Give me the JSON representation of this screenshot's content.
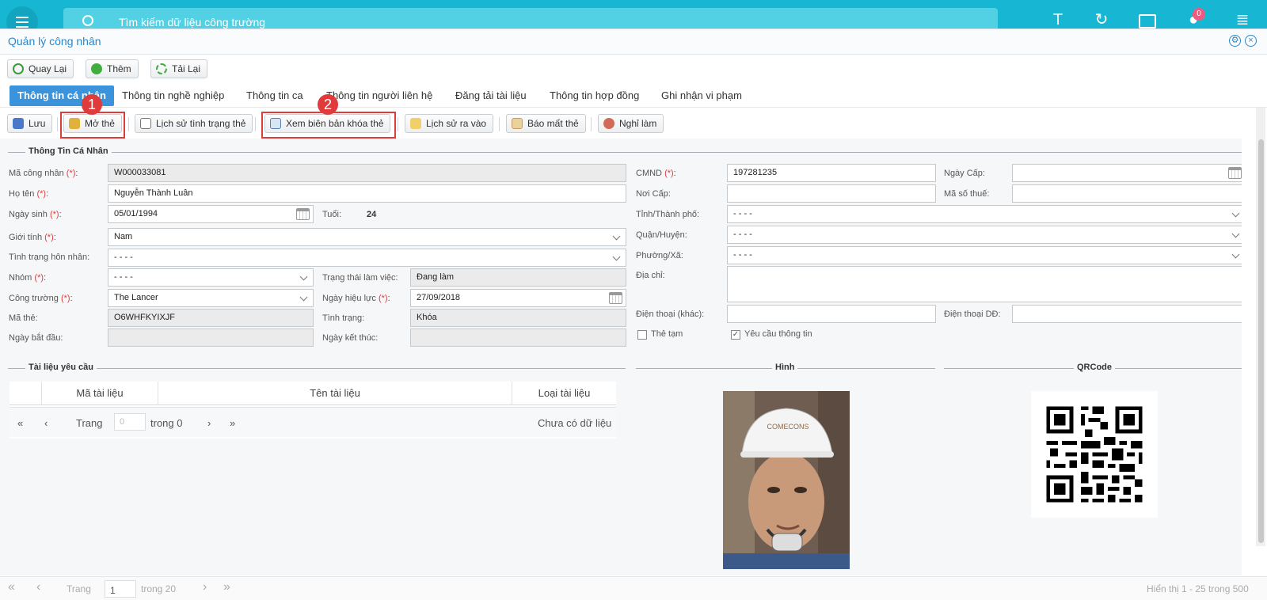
{
  "appbar": {
    "search_placeholder": "Tìm kiếm dữ liệu công trường",
    "user_initial": "T",
    "notif_count": "0"
  },
  "modal": {
    "title": "Quản lý công nhân"
  },
  "toolbar1": {
    "back_label": "Quay Lại",
    "add_label": "Thêm",
    "reload_label": "Tải Lại"
  },
  "tabs": [
    {
      "label": "Thông tin cá nhân",
      "active": true
    },
    {
      "label": "Thông tin nghề nghiệp"
    },
    {
      "label": "Thông tin ca"
    },
    {
      "label": "Thông tin người liên hệ"
    },
    {
      "label": "Đăng tải tài liệu"
    },
    {
      "label": "Thông tin hợp đồng"
    },
    {
      "label": "Ghi nhận vi phạm"
    }
  ],
  "toolbar2": {
    "save_label": "Lưu",
    "unlock_card_label": "Mở thẻ",
    "card_status_history_label": "Lịch sử tình trạng thẻ",
    "view_lock_record_label": "Xem biên bản khóa thẻ",
    "entry_history_label": "Lịch sử ra vào",
    "report_lost_label": "Báo mất thẻ",
    "leave_label": "Nghỉ làm"
  },
  "annotations": {
    "step1": "1",
    "step2": "2"
  },
  "personal": {
    "section_title": "Thông Tin Cá Nhân",
    "worker_code_label": "Mã công nhân",
    "worker_code": "W000033081",
    "full_name_label": "Họ tên",
    "full_name": "Nguyễn Thành Luân",
    "dob_label": "Ngày sinh",
    "dob": "05/01/1994",
    "age_label": "Tuổi:",
    "age": "24",
    "gender_label": "Giới tính",
    "gender": "Nam",
    "marital_label": "Tình trạng hôn nhân:",
    "marital": "- - - -",
    "group_label": "Nhóm",
    "group": "- - - -",
    "work_status_label": "Trạng thái làm việc:",
    "work_status": "Đang làm",
    "site_label": "Công trường",
    "site": "The Lancer",
    "effective_date_label": "Ngày hiệu lực",
    "effective_date": "27/09/2018",
    "card_code_label": "Mã thẻ:",
    "card_code": "O6WHFKYIXJF",
    "card_state_label": "Tình trạng:",
    "card_state": "Khóa",
    "start_date_label": "Ngày bắt đầu:",
    "end_date_label": "Ngày kết thúc:",
    "id_label": "CMND",
    "id_number": "197281235",
    "issue_date_label": "Ngày Cấp:",
    "issue_place_label": "Nơi Cấp:",
    "tax_code_label": "Mã số thuế:",
    "province_label": "Tỉnh/Thành phố:",
    "province": "- - - -",
    "district_label": "Quận/Huyện:",
    "district": "- - - -",
    "ward_label": "Phường/Xã:",
    "ward": "- - - -",
    "address_label": "Địa chỉ:",
    "phone_other_label": "Điện thoại (khác):",
    "mobile_label": "Điện thoại DĐ:",
    "temp_card_label": "Thẻ tạm",
    "temp_card_checked": false,
    "require_info_label": "Yêu cầu thông tin",
    "require_info_checked": true,
    "required_mark": "(*)",
    "colon": ":"
  },
  "documents": {
    "section_title": "Tài liệu yêu cầu",
    "columns": [
      "Mã tài liệu",
      "Tên tài liệu",
      "Loại tài liệu"
    ],
    "pager_page_label": "Trang",
    "pager_page_value": "0",
    "pager_of_label": "trong 0",
    "empty_text": "Chưa có dữ liệu"
  },
  "photo_section": {
    "title": "Hình",
    "helmet_text": "COMECONS"
  },
  "qr_section": {
    "title": "QRCode"
  },
  "statusbar": {
    "page_label": "Trang",
    "page_value": "1",
    "of_label": "trong 20",
    "showing": "Hiển thị 1 - 25 trong 500"
  },
  "colors": {
    "appbar": "#17b7d3",
    "tab_active": "#3b93db",
    "highlight": "#e03b3b",
    "title": "#2d86c6"
  }
}
